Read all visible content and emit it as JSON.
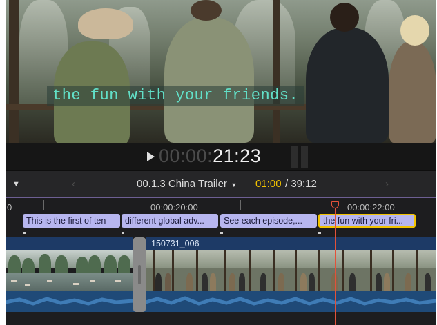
{
  "viewer": {
    "subtitle_text": "the fun with your friends.",
    "timecode_dim": "00:00:",
    "timecode_bright": "21:23"
  },
  "timeline_header": {
    "project_title": "00.1.3 China Trailer",
    "current_duration": "01:00",
    "total_duration": "/ 39:12"
  },
  "ruler": {
    "labels": [
      "0",
      "00:00:20:00",
      "00:00:22:00"
    ]
  },
  "captions": [
    {
      "text": "This is the first of ten",
      "selected": false
    },
    {
      "text": "different global adv...",
      "selected": false
    },
    {
      "text": "See each episode,...",
      "selected": false
    },
    {
      "text": "the fun with your fri...",
      "selected": true
    }
  ],
  "clips": {
    "clip_b_name": "150731_006"
  },
  "colors": {
    "caption_bg": "#b7b6ef",
    "selection": "#f2c300",
    "playhead": "#e2523a",
    "clip_header": "#1d3a66",
    "audio": "#1f4a78",
    "subtitle": "#62e0c8"
  },
  "icons": {
    "play": "play-icon",
    "chevron_down": "chevron-down-icon",
    "back": "chevron-left-icon",
    "forward": "chevron-right-icon"
  }
}
